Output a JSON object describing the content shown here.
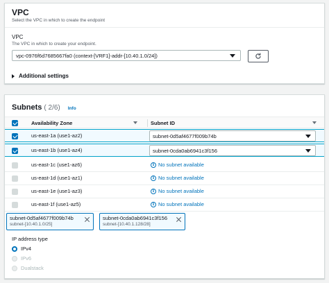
{
  "vpc_section": {
    "title": "VPC",
    "description": "Select the VPC in which to create the endpoint",
    "field_label": "VPC",
    "field_description": "The VPC in which to create your endpoint.",
    "selected_vpc": "vpc-0976f6d7685667fa0 (context-[VRF1]-addr-[10.40.1.0/24])",
    "refresh_icon": "refresh-icon",
    "additional_settings_label": "Additional settings"
  },
  "subnets_section": {
    "title": "Subnets",
    "count": "( 2/6)",
    "info_label": "Info",
    "columns": {
      "availability_zone": "Availability Zone",
      "subnet_id": "Subnet ID"
    },
    "rows": [
      {
        "zone": "us-east-1a (use1-az2)",
        "checked": true,
        "subnet": "subnet-0d5af4677f009b74b"
      },
      {
        "zone": "us-east-1b (use1-az4)",
        "checked": true,
        "subnet": "subnet-0cda0ab6941c3f156"
      },
      {
        "zone": "us-east-1c (use1-az6)",
        "checked": false,
        "subnet": "No subnet available"
      },
      {
        "zone": "us-east-1d (use1-az1)",
        "checked": false,
        "subnet": "No subnet available"
      },
      {
        "zone": "us-east-1e (use1-az3)",
        "checked": false,
        "subnet": "No subnet available"
      },
      {
        "zone": "us-east-1f (use1-az5)",
        "checked": false,
        "subnet": "No subnet available"
      }
    ],
    "tokens": [
      {
        "name": "subnet-0d5af4677f009b74b",
        "cidr": "subnet-[10.40.1.0/25]"
      },
      {
        "name": "subnet-0cda0ab6941c3f156",
        "cidr": "subnet-[10.40.1.128/28]"
      }
    ],
    "ip_address_type": {
      "label": "IP address type",
      "options": [
        {
          "label": "IPv4",
          "selected": true,
          "disabled": false
        },
        {
          "label": "IPv6",
          "selected": false,
          "disabled": true
        },
        {
          "label": "Dualstack",
          "selected": false,
          "disabled": true
        }
      ]
    }
  },
  "colors": {
    "accent": "#0073bb",
    "selected_row_bg": "#f1faff",
    "border": "#d5dbdb"
  }
}
